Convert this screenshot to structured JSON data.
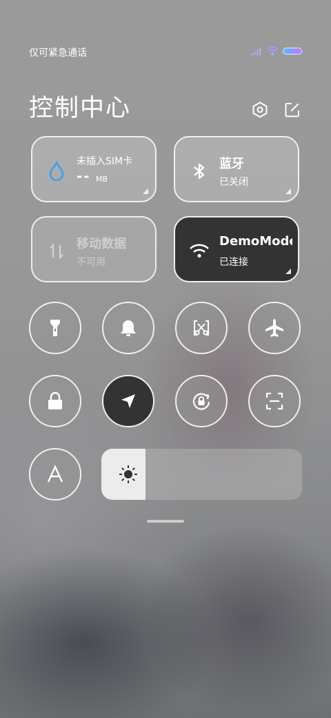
{
  "status": {
    "carrier_text": "仅可紧急通话"
  },
  "header": {
    "title": "控制中心"
  },
  "tiles": {
    "data": {
      "line1": "未插入SIM卡",
      "value": "--",
      "unit": "MB"
    },
    "bluetooth": {
      "label": "蓝牙",
      "state": "已关闭"
    },
    "mobile_data": {
      "label": "移动数据",
      "state": "不可用"
    },
    "wifi": {
      "label": "DemoMode",
      "state": "已连接"
    }
  },
  "toggles": [
    {
      "name": "flashlight",
      "icon": "flashlight-icon",
      "active": false
    },
    {
      "name": "mute",
      "icon": "bell-icon",
      "active": false
    },
    {
      "name": "screenshot",
      "icon": "scissors-icon",
      "active": false
    },
    {
      "name": "airplane",
      "icon": "airplane-icon",
      "active": false
    },
    {
      "name": "lock",
      "icon": "lock-icon",
      "active": false
    },
    {
      "name": "location",
      "icon": "location-arrow-icon",
      "active": true
    },
    {
      "name": "rotation-lock",
      "icon": "rotation-lock-icon",
      "active": false
    },
    {
      "name": "scanner",
      "icon": "scan-icon",
      "active": false
    },
    {
      "name": "auto-brightness",
      "icon": "letter-a-icon",
      "active": false
    }
  ],
  "brightness": {
    "level": 0.22
  },
  "colors": {
    "accent_blue": "#3aa0e8",
    "active_tile": "#333333"
  }
}
